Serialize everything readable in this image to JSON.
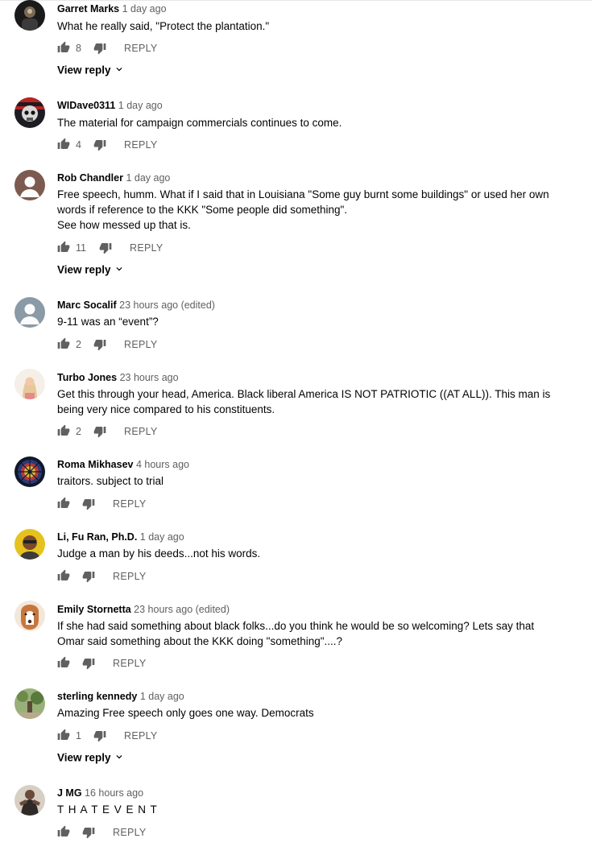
{
  "comments": [
    {
      "author": "Garret Marks",
      "time": "1 day ago",
      "lines": [
        "What he really said, \"Protect the plantation.\""
      ],
      "likes": "8",
      "reply": "REPLY",
      "view_reply": "View reply"
    },
    {
      "author": "WIDave0311",
      "time": "1 day ago",
      "lines": [
        "The material for campaign commercials continues to come."
      ],
      "likes": "4",
      "reply": "REPLY"
    },
    {
      "author": "Rob Chandler",
      "time": "1 day ago",
      "lines": [
        "Free speech, humm.  What if I said that in Louisiana \"Some guy burnt some buildings\" or used her own",
        "words if reference to the KKK \"Some people did something\".",
        "See how messed up that is."
      ],
      "likes": "11",
      "reply": "REPLY",
      "view_reply": "View reply"
    },
    {
      "author": "Marc Socalif",
      "time": "23 hours ago (edited)",
      "lines": [
        "9-11 was an “event”?"
      ],
      "likes": "2",
      "reply": "REPLY"
    },
    {
      "author": "Turbo Jones",
      "time": "23 hours ago",
      "lines": [
        "Get this through your head, America.   Black liberal America IS NOT PATRIOTIC ((AT ALL)). This man is",
        "being very nice compared to his constituents."
      ],
      "likes": "2",
      "reply": "REPLY"
    },
    {
      "author": "Roma Mikhasev",
      "time": "4 hours ago",
      "lines": [
        "traitors. subject to trial"
      ],
      "likes": "",
      "reply": "REPLY"
    },
    {
      "author": "Li, Fu Ran, Ph.D.",
      "time": "1 day ago",
      "lines": [
        "Judge a man by his deeds...not his words."
      ],
      "likes": "",
      "reply": "REPLY"
    },
    {
      "author": "Emily Stornetta",
      "time": "23 hours ago (edited)",
      "lines": [
        "If she had said something about black folks...do you think he would be so welcoming?  Lets say that",
        "Omar said something about the KKK doing \"something\"....?"
      ],
      "likes": "",
      "reply": "REPLY"
    },
    {
      "author": "sterling kennedy",
      "time": "1 day ago",
      "lines": [
        "Amazing Free speech only goes one way. Democrats"
      ],
      "likes": "1",
      "reply": "REPLY",
      "view_reply": "View reply"
    },
    {
      "author": "J MG",
      "time": "16 hours ago",
      "lines": [
        "T H A T   E V E N T"
      ],
      "likes": "",
      "reply": "REPLY"
    }
  ],
  "colors": {
    "primary_text": "#030303",
    "secondary_text": "#606060",
    "icon": "#606060"
  },
  "icons": {
    "like": "thumb-up-icon",
    "dislike": "thumb-down-icon",
    "expand": "chevron-down-icon"
  }
}
